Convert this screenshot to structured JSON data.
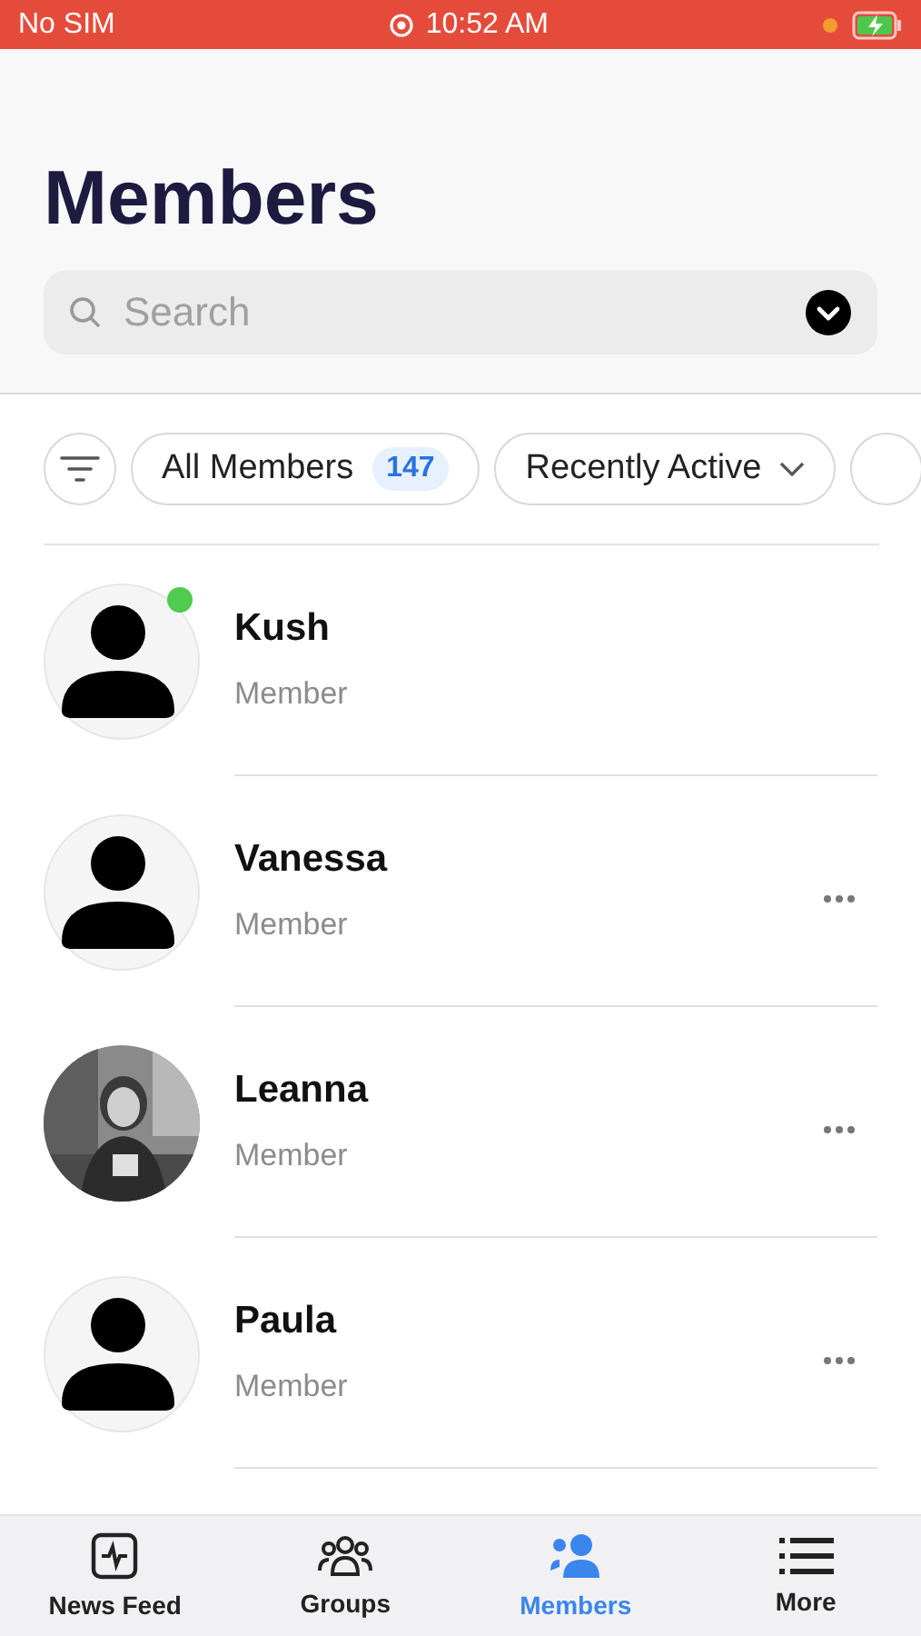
{
  "status_bar": {
    "carrier": "No SIM",
    "time": "10:52 AM"
  },
  "title": "Members",
  "search": {
    "placeholder": "Search"
  },
  "filters": [
    {
      "kind": "count",
      "label": "All Members",
      "count": "147"
    },
    {
      "kind": "dropdown",
      "label": "Recently Active"
    },
    {
      "kind": "cut"
    }
  ],
  "members": [
    {
      "name": "Kush",
      "role": "Member",
      "online": true,
      "menu": false
    },
    {
      "name": "Vanessa",
      "role": "Member",
      "online": false,
      "menu": true
    },
    {
      "name": "Leanna",
      "role": "Member",
      "kind": "picture",
      "online": false,
      "menu": true
    },
    {
      "name": "Paula",
      "role": "Member",
      "online": false,
      "menu": true
    }
  ],
  "tab_bar": [
    {
      "label": "News Feed",
      "selected": false
    },
    {
      "label": "Groups",
      "selected": false
    },
    {
      "label": "Members",
      "selected": true
    },
    {
      "label": "More",
      "selected": false
    }
  ]
}
